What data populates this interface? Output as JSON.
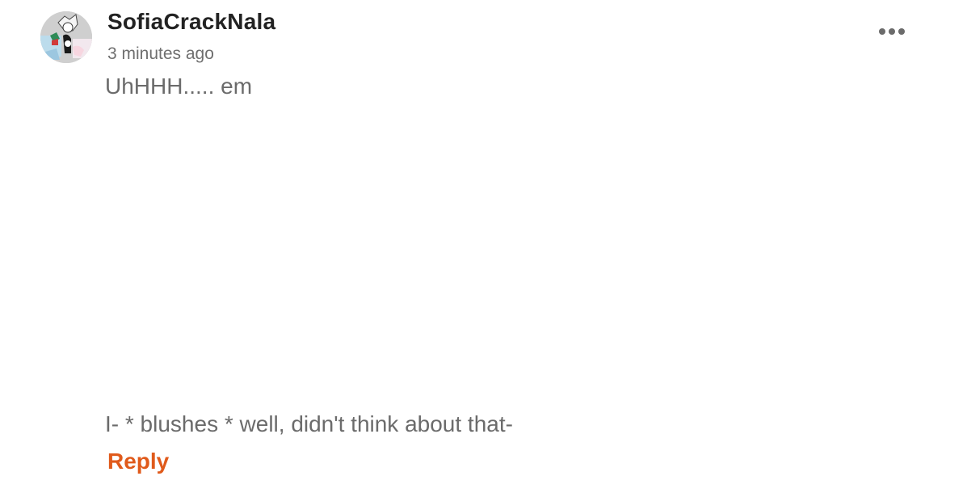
{
  "comment": {
    "author": {
      "username": "SofiaCrackNala",
      "avatar_icon": "user-avatar-image"
    },
    "timestamp": "3 minutes ago",
    "more_icon": "more-horizontal-icon",
    "body": {
      "line_1": "UhHHH..... em",
      "line_2": "I- * blushes * well, didn't think about that-"
    },
    "reply_label": "Reply"
  },
  "colors": {
    "username": "#222222",
    "meta": "#6f6f6f",
    "body_text": "#6b6b6b",
    "reply_accent": "#e05a1b",
    "more_dots": "#6b6b6b"
  }
}
